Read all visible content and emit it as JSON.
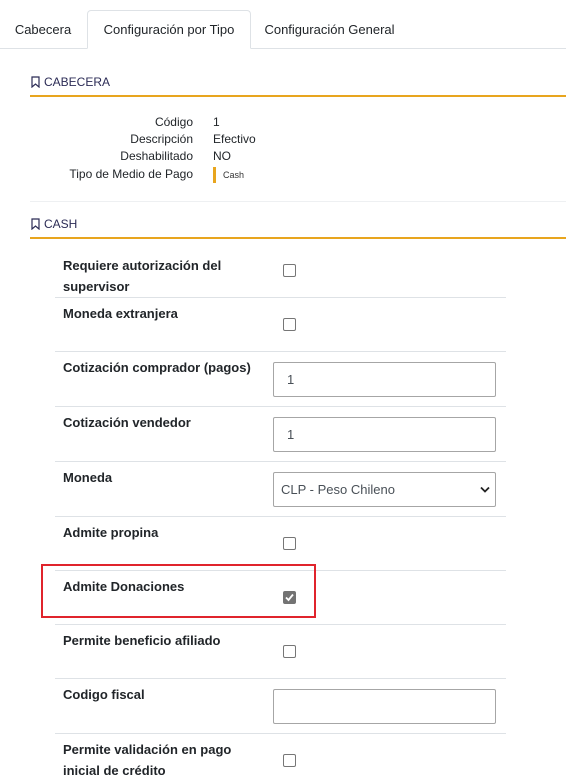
{
  "tabs": [
    {
      "label": "Cabecera",
      "active": false
    },
    {
      "label": "Configuración por Tipo",
      "active": true
    },
    {
      "label": "Configuración General",
      "active": false
    }
  ],
  "cabecera": {
    "title": "CABECERA",
    "rows": [
      {
        "label": "Código",
        "value": "1"
      },
      {
        "label": "Descripción",
        "value": "Efectivo"
      },
      {
        "label": "Deshabilitado",
        "value": "NO"
      },
      {
        "label": "Tipo de Medio de Pago",
        "value": "Cash"
      }
    ]
  },
  "cash": {
    "title": "CASH",
    "fields": [
      {
        "label": "Requiere autorización del supervisor",
        "type": "checkbox",
        "checked": false
      },
      {
        "label": "Moneda extranjera",
        "type": "checkbox",
        "checked": false
      },
      {
        "label": "Cotización comprador (pagos)",
        "type": "text",
        "value": "1"
      },
      {
        "label": "Cotización vendedor",
        "type": "text",
        "value": "1"
      },
      {
        "label": "Moneda",
        "type": "select",
        "value": "CLP - Peso Chileno"
      },
      {
        "label": "Admite propina",
        "type": "checkbox",
        "checked": false
      },
      {
        "label": "Admite Donaciones",
        "type": "checkbox",
        "checked": true
      },
      {
        "label": "Permite beneficio afiliado",
        "type": "checkbox",
        "checked": false
      },
      {
        "label": "Codigo fiscal",
        "type": "text",
        "value": ""
      },
      {
        "label": "Permite validación en pago inicial de crédito",
        "type": "checkbox",
        "checked": false
      }
    ]
  },
  "colors": {
    "accent": "#e8a51e",
    "highlight": "#e0242c",
    "checkbox_checked": "#737373"
  },
  "icons": {
    "section": "bookmark-icon",
    "select": "chevron-down-icon",
    "check": "checkmark-icon"
  }
}
